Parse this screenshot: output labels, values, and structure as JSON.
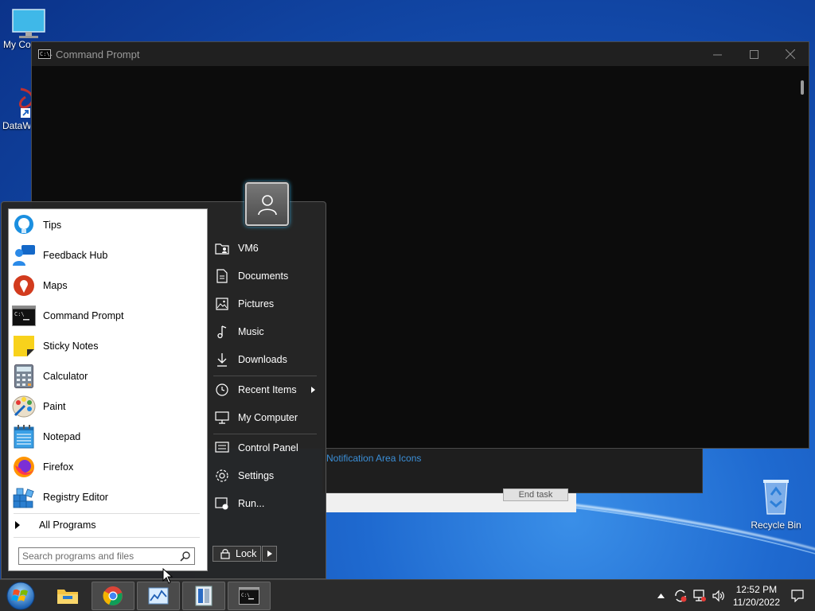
{
  "desktop": {
    "icons": [
      {
        "label": "My Computer"
      },
      {
        "label": "DataWedge"
      },
      {
        "label": "Recycle Bin"
      }
    ]
  },
  "background_window": {
    "link_text": "Notification Area Icons",
    "end_task_label": "End task"
  },
  "cmd_window": {
    "title": "Command Prompt",
    "icon_text": "C:\\."
  },
  "start_menu": {
    "programs": [
      {
        "label": "Tips",
        "icon": "lightbulb-icon"
      },
      {
        "label": "Feedback Hub",
        "icon": "feedback-hub-icon"
      },
      {
        "label": "Maps",
        "icon": "maps-pin-icon"
      },
      {
        "label": "Command Prompt",
        "icon": "command-prompt-icon"
      },
      {
        "label": "Sticky Notes",
        "icon": "sticky-notes-icon"
      },
      {
        "label": "Calculator",
        "icon": "calculator-icon"
      },
      {
        "label": "Paint",
        "icon": "paint-palette-icon"
      },
      {
        "label": "Notepad",
        "icon": "notepad-icon"
      },
      {
        "label": "Firefox",
        "icon": "firefox-icon"
      },
      {
        "label": "Registry Editor",
        "icon": "registry-editor-icon"
      }
    ],
    "all_programs_label": "All Programs",
    "search_placeholder": "Search programs and files",
    "right_items": [
      {
        "label": "VM6",
        "icon": "user-folder-icon"
      },
      {
        "label": "Documents",
        "icon": "document-icon"
      },
      {
        "label": "Pictures",
        "icon": "picture-icon"
      },
      {
        "label": "Music",
        "icon": "music-note-icon"
      },
      {
        "label": "Downloads",
        "icon": "download-icon"
      },
      {
        "label": "Recent Items",
        "icon": "clock-icon"
      },
      {
        "label": "My Computer",
        "icon": "computer-icon"
      },
      {
        "label": "Control Panel",
        "icon": "control-panel-icon"
      },
      {
        "label": "Settings",
        "icon": "gear-icon"
      },
      {
        "label": "Run...",
        "icon": "run-icon"
      }
    ],
    "lock_label": "Lock"
  },
  "taskbar": {
    "time": "12:52 PM",
    "date": "11/20/2022"
  }
}
